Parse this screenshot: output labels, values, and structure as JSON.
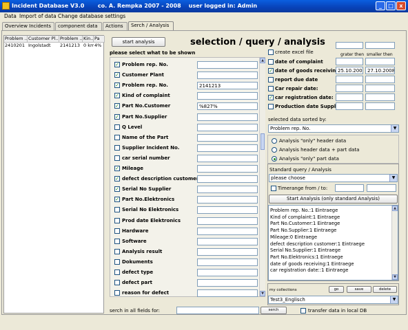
{
  "window": {
    "title": "Incident Database V3.0       co. A. Rempka 2007 - 2008    user logged in: Admin",
    "min": "_",
    "max": "□",
    "close": "x"
  },
  "menu": [
    "Data",
    "Import of data",
    "Change database settings"
  ],
  "tabs": [
    "Overview Incidents",
    "component data",
    "Actions",
    "Serch / Analysis"
  ],
  "left_table": {
    "headers": [
      "Problem ...",
      "Customer Pl...",
      "Problem ...",
      "Kin...",
      "Pa"
    ],
    "rows": [
      [
        "2410201",
        "Ingolstadt",
        "2141213",
        "0 km",
        "4%"
      ]
    ]
  },
  "start_analysis": "start analysis",
  "heading": "selection / query / analysis",
  "select_hint": "please select what to be shown",
  "fields": [
    {
      "label": "Problem rep. No.",
      "checked": true,
      "value": ""
    },
    {
      "label": "Customer Plant",
      "checked": true,
      "value": ""
    },
    {
      "label": "Problem rep. No.",
      "checked": true,
      "value": "2141213"
    },
    {
      "label": "Kind of complaint",
      "checked": true,
      "value": ""
    },
    {
      "label": "Part No.Customer",
      "checked": true,
      "value": "%827%"
    },
    {
      "label": "Part No.Supplier",
      "checked": true,
      "value": ""
    },
    {
      "label": "Q Level",
      "checked": false,
      "value": ""
    },
    {
      "label": "Name of the Part",
      "checked": false,
      "value": ""
    },
    {
      "label": "Supplier Incident No.",
      "checked": false,
      "value": ""
    },
    {
      "label": "car serial number",
      "checked": false,
      "value": ""
    },
    {
      "label": "Mileage",
      "checked": true,
      "value": ""
    },
    {
      "label": "defect description customer",
      "checked": true,
      "value": ""
    },
    {
      "label": "Serial No Supplier",
      "checked": true,
      "value": ""
    },
    {
      "label": "Part No.Elektronics",
      "checked": true,
      "value": ""
    },
    {
      "label": "Serial No Elektronics",
      "checked": false,
      "value": ""
    },
    {
      "label": "Prod date Elektronics",
      "checked": false,
      "value": ""
    },
    {
      "label": "Hardware",
      "checked": false,
      "value": ""
    },
    {
      "label": "Software",
      "checked": false,
      "value": ""
    },
    {
      "label": "Analysis result",
      "checked": false,
      "value": ""
    },
    {
      "label": "Dokuments",
      "checked": false,
      "value": ""
    },
    {
      "label": "defect type",
      "checked": false,
      "value": ""
    },
    {
      "label": "defect part",
      "checked": false,
      "value": ""
    },
    {
      "label": "reason for defect",
      "checked": false,
      "value": ""
    }
  ],
  "search_all_label": "serch in all fields for:",
  "search_btn": "serch",
  "transfer_label": "transfer data in local DB",
  "create_excel": "create excel file",
  "greater_label": "grater then",
  "smaller_label": "smaller then",
  "dates": [
    {
      "label": "date of complaint",
      "checked": false,
      "from": "",
      "to": ""
    },
    {
      "label": "date of goods receiving",
      "checked": true,
      "from": "25.10.2008",
      "to": "27.10.2008"
    },
    {
      "label": "report due date",
      "checked": false,
      "from": "",
      "to": ""
    },
    {
      "label": "Car repair date:",
      "checked": false,
      "from": "",
      "to": ""
    },
    {
      "label": "car registration date:",
      "checked": true,
      "from": "",
      "to": ""
    },
    {
      "label": "Production date Supplier:",
      "checked": false,
      "from": "",
      "to": ""
    }
  ],
  "sorted_label": "selected data sorted by:",
  "sorted_value": "Problem rep. No.",
  "radios": [
    {
      "label": "Analysis \"only\" header data",
      "on": false
    },
    {
      "label": "Analysis header data + part data",
      "on": false
    },
    {
      "label": "Analysis \"only\" part data",
      "on": true
    }
  ],
  "std_query_label": "Standard query / Analysis",
  "std_query_value": "please choose",
  "timerange_label": "Timerange from / to:",
  "start_std": "Start Analysis (only standard Analysis)",
  "result_lines": [
    "Problem rep. No.:1 Eintraege",
    "Kind of complaint:1 Eintraege",
    "Part No.Customer:1 Eintraege",
    "Part No.Supplier:1 Eintraege",
    "Mileage:0 Eintraege",
    "defect description customer:1 Eintraege",
    "Serial No.Supplier:1 Eintraege",
    "Part No.Elektronics:1 Eintraege",
    "date of goods receiving:1 Eintraege",
    "car registration date::1 Eintraege"
  ],
  "collections_label": "my collections",
  "go": "go",
  "save": "save",
  "delete": "delete",
  "collection_value": "Test3_Englisch"
}
